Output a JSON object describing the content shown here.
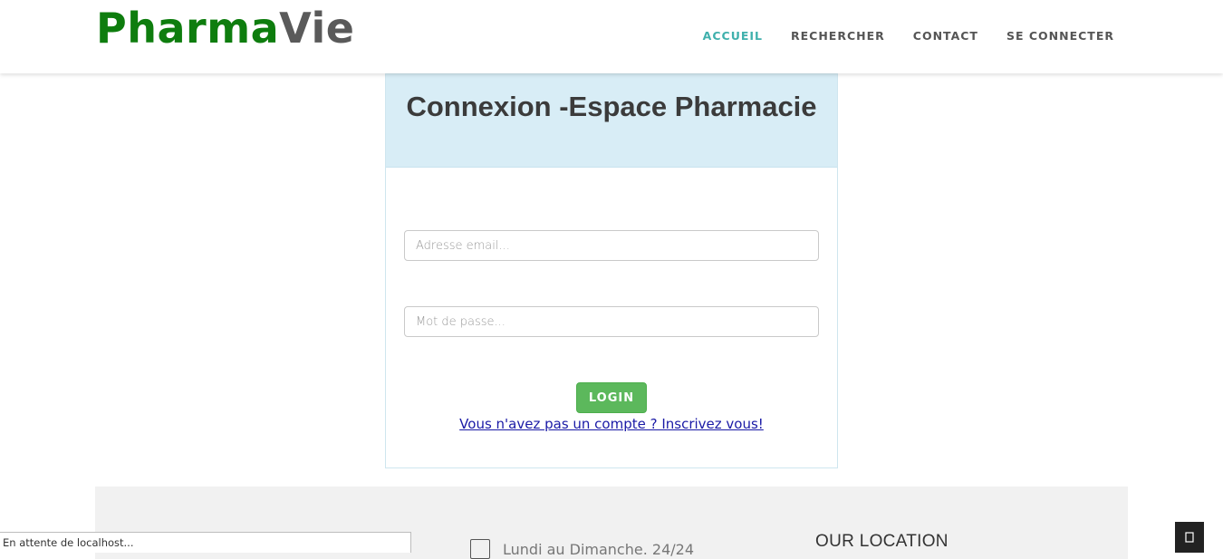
{
  "brand": {
    "name_part1": "Pharma",
    "name_part2": "Vie",
    "color_part1": "#0e7d0e",
    "color_part2": "#5a5a5a"
  },
  "nav": {
    "items": [
      {
        "label": "ACCUEIL",
        "active": true
      },
      {
        "label": "RECHERCHER",
        "active": false
      },
      {
        "label": "CONTACT",
        "active": false
      },
      {
        "label": "SE CONNECTER",
        "active": false
      }
    ],
    "active_color": "#3fb0ac"
  },
  "login": {
    "title": "Connexion -Espace Pharmacie",
    "email_placeholder": "Adresse email...",
    "password_placeholder": "Mot de passe...",
    "button_label": "LOGIN",
    "button_color": "#5cb85c",
    "signup_link": "Vous n'avez pas un compte ? Inscrivez vous!"
  },
  "footer": {
    "hours_text": "Lundi au Dimanche. 24/24",
    "hours_icon": "clock-icon",
    "location_title": "OUR LOCATION"
  },
  "status_bar": {
    "text": "En attente de localhost..."
  },
  "scroll_top": {
    "icon": "arrow-up-icon"
  }
}
